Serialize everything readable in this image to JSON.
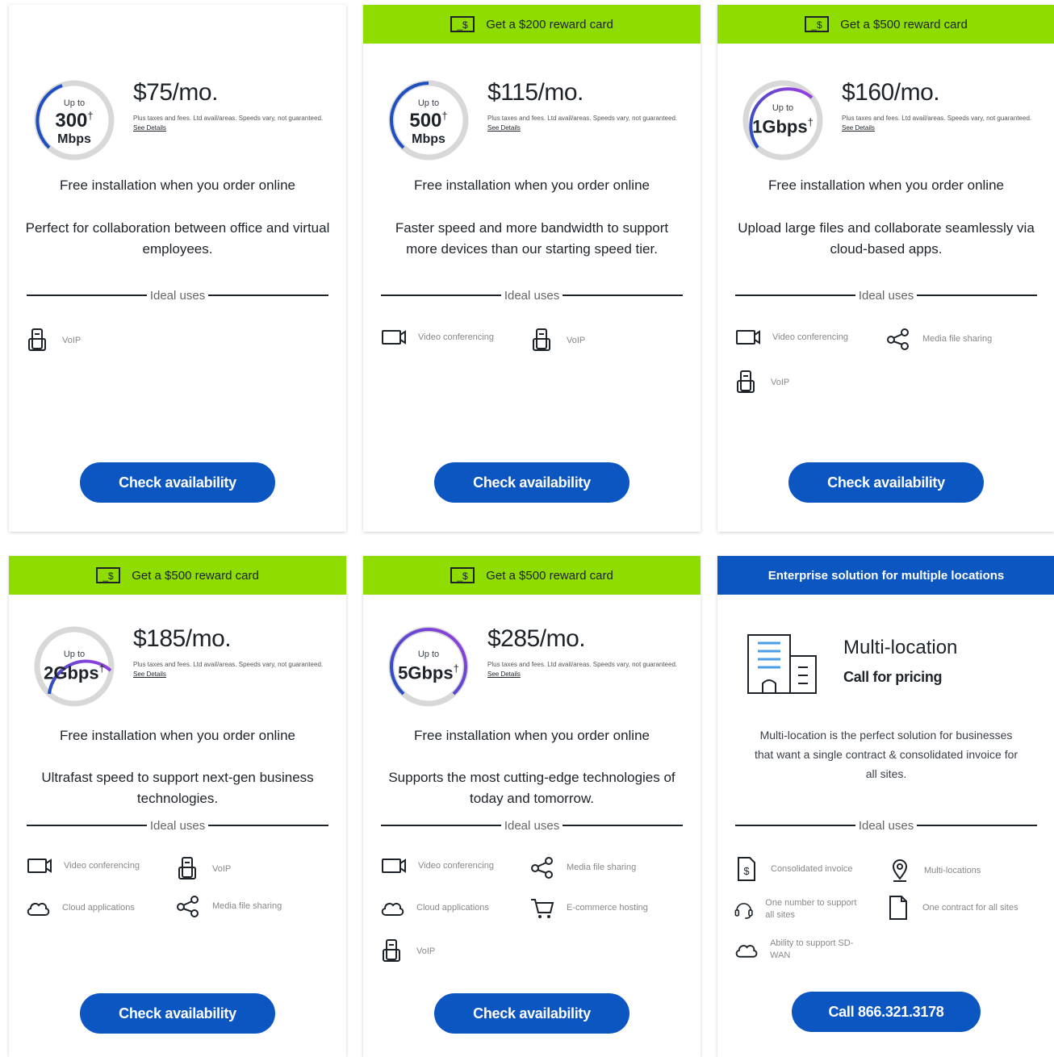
{
  "cards": [
    {
      "banner": "",
      "speed_upto": "Up to",
      "speed_value": "300",
      "speed_mark": "†",
      "speed_unit": "Mbps",
      "price": "$75/mo.",
      "fine_print": "Plus taxes and fees. Ltd avail/areas. Speeds vary, not guaranteed.",
      "see_details": "See Details",
      "free_install": "Free installation when you order online",
      "description": "Perfect for collaboration between office and virtual employees.",
      "ideal_label": "Ideal uses",
      "uses": [
        {
          "icon": "voip-phone-icon",
          "label": "VoIP"
        }
      ],
      "cta": "Check availability"
    },
    {
      "banner": "Get a $200 reward card",
      "speed_upto": "Up to",
      "speed_value": "500",
      "speed_mark": "†",
      "speed_unit": "Mbps",
      "price": "$115/mo.",
      "fine_print": "Plus taxes and fees. Ltd avail/areas. Speeds vary, not guaranteed.",
      "see_details": "See Details",
      "free_install": "Free installation when you order online",
      "description": "Faster speed and more bandwidth to support more devices than our starting speed tier.",
      "ideal_label": "Ideal uses",
      "uses": [
        {
          "icon": "video-camera-icon",
          "label": "Video conferencing"
        },
        {
          "icon": "voip-phone-icon",
          "label": "VoIP"
        }
      ],
      "cta": "Check availability"
    },
    {
      "banner": "Get a $500 reward card",
      "speed_upto": "Up to",
      "speed_value": "1Gbps",
      "speed_mark": "†",
      "speed_unit": "",
      "price": "$160/mo.",
      "fine_print": "Plus taxes and fees. Ltd avail/areas. Speeds vary, not guaranteed.",
      "see_details": "See Details",
      "free_install": "Free installation when you order online",
      "description": "Upload large files and collaborate seamlessly via cloud-based apps.",
      "ideal_label": "Ideal uses",
      "uses": [
        {
          "icon": "video-camera-icon",
          "label": "Video conferencing"
        },
        {
          "icon": "share-icon",
          "label": "Media file sharing"
        },
        {
          "icon": "voip-phone-icon",
          "label": "VoIP"
        }
      ],
      "cta": "Check availability"
    },
    {
      "banner": "Get a $500 reward card",
      "speed_upto": "Up to",
      "speed_value": "2Gbps",
      "speed_mark": "†",
      "speed_unit": "",
      "price": "$185/mo.",
      "fine_print": "Plus taxes and fees. Ltd avail/areas. Speeds vary, not guaranteed.",
      "see_details": "See Details",
      "free_install": "Free installation when you order online",
      "description": "Ultrafast speed to support next-gen business technologies.",
      "ideal_label": "Ideal uses",
      "uses": [
        {
          "icon": "video-camera-icon",
          "label": "Video conferencing"
        },
        {
          "icon": "voip-phone-icon",
          "label": "VoIP"
        },
        {
          "icon": "cloud-icon",
          "label": "Cloud applications"
        },
        {
          "icon": "share-icon",
          "label": "Media file sharing"
        }
      ],
      "cta": "Check availability"
    },
    {
      "banner": "Get a $500 reward card",
      "speed_upto": "Up to",
      "speed_value": "5Gbps",
      "speed_mark": "†",
      "speed_unit": "",
      "price": "$285/mo.",
      "fine_print": "Plus taxes and fees. Ltd avail/areas. Speeds vary, not guaranteed.",
      "see_details": "See Details",
      "free_install": "Free installation when you order online",
      "description": "Supports the most cutting-edge technologies of today and tomorrow.",
      "ideal_label": "Ideal uses",
      "uses": [
        {
          "icon": "video-camera-icon",
          "label": "Video conferencing"
        },
        {
          "icon": "share-icon",
          "label": "Media file sharing"
        },
        {
          "icon": "cloud-icon",
          "label": "Cloud applications"
        },
        {
          "icon": "cart-icon",
          "label": "E-commerce hosting"
        },
        {
          "icon": "voip-phone-icon",
          "label": "VoIP"
        }
      ],
      "cta": "Check availability"
    },
    {
      "banner": "Enterprise solution for multiple locations",
      "title": "Multi-location",
      "subtitle": "Call for pricing",
      "description": "Multi-location is the perfect solution for businesses that want a single contract & consolidated invoice for all sites.",
      "ideal_label": "Ideal uses",
      "uses": [
        {
          "icon": "invoice-icon",
          "label": "Consolidated invoice"
        },
        {
          "icon": "location-pin-icon",
          "label": "Multi-locations"
        },
        {
          "icon": "headset-icon",
          "label": "One number to support all sites"
        },
        {
          "icon": "document-icon",
          "label": "One contract for all sites"
        },
        {
          "icon": "cloud-icon",
          "label": "Ability to support SD-WAN"
        }
      ],
      "cta": "Call 866.321.3178"
    }
  ],
  "colors": {
    "accent_blue": "#0c56c2",
    "banner_green": "#8fdc00",
    "gauge_blue": "#1f4fbf",
    "gauge_purple": "#9b3fe0"
  }
}
